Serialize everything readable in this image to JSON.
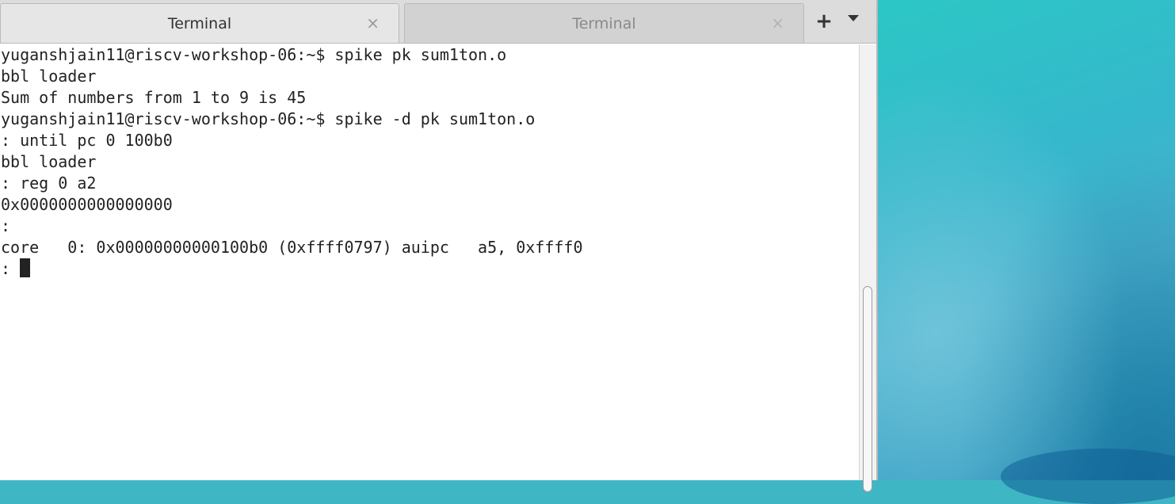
{
  "tabs": [
    {
      "label": "Terminal",
      "active": true,
      "close": "×"
    },
    {
      "label": "Terminal",
      "active": false,
      "close": "×"
    }
  ],
  "toolbar": {
    "new_tab": "+",
    "menu_icon": "chevron-down-icon"
  },
  "terminal": {
    "lines": [
      "yuganshjain11@riscv-workshop-06:~$ spike pk sum1ton.o",
      "bbl loader",
      "Sum of numbers from 1 to 9 is 45",
      "yuganshjain11@riscv-workshop-06:~$ spike -d pk sum1ton.o",
      ": until pc 0 100b0",
      "bbl loader",
      ": reg 0 a2",
      "0x0000000000000000",
      ":",
      "core   0: 0x00000000000100b0 (0xffff0797) auipc   a5, 0xffff0"
    ],
    "prompt": ": "
  },
  "colors": {
    "terminal_bg": "#ffffff",
    "terminal_fg": "#222222",
    "tabbar_bg": "#dcdcdc",
    "desktop_accent": "#3fb6c4"
  }
}
